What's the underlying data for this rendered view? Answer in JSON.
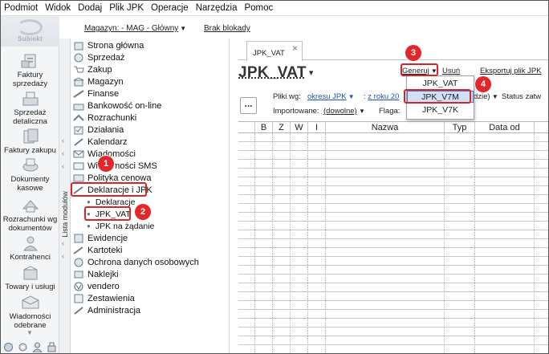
{
  "menu": [
    "Podmiot",
    "Widok",
    "Dodaj",
    "Plik JPK",
    "Operacje",
    "Narzędzia",
    "Pomoc"
  ],
  "toolbar": {
    "warehouse": "Magazyn: - MAG - Główny",
    "sync": "Brak blokady"
  },
  "logo": "Subiekt",
  "sidebar": [
    {
      "label_line1": "Faktury",
      "label_line2": "sprzedaży"
    },
    {
      "label_line1": "Sprzedaż",
      "label_line2": "detaliczna"
    },
    {
      "label_line1": "Faktury zakupu",
      "label_line2": ""
    },
    {
      "label_line1": "Dokumenty",
      "label_line2": "kasowe"
    },
    {
      "label_line1": "Rozrachunki wg",
      "label_line2": "dokumentów"
    },
    {
      "label_line1": "Kontrahenci",
      "label_line2": ""
    },
    {
      "label_line1": "Towary i usługi",
      "label_line2": ""
    },
    {
      "label_line1": "Wiadomości",
      "label_line2": "odebrane"
    }
  ],
  "modules_label": "Lista modułów",
  "tree": [
    "Strona główna",
    "Sprzedaż",
    "Zakup",
    "Magazyn",
    "Finanse",
    "Bankowość on-line",
    "Rozrachunki",
    "Działania",
    "Kalendarz",
    "Wiadomości",
    "Wiadomości SMS",
    "Polityka cenowa",
    "Deklaracje i JPK"
  ],
  "tree_sub": [
    "Deklaracje",
    "JPK_VAT",
    "JPK na żądanie"
  ],
  "tree_after": [
    "Ewidencje",
    "Kartoteki",
    "Ochrona danych osobowych",
    "Naklejki",
    "vendero",
    "Zestawienia",
    "Administracja"
  ],
  "tab": {
    "label": "JPK_VAT",
    "close": "×"
  },
  "page": {
    "title": "JPK_VAT"
  },
  "actions": {
    "generate": "Generuj",
    "delete": "Usuń",
    "export": "Eksportuj plik JPK"
  },
  "filters": {
    "files_by_label": "Pliki wg:",
    "files_by_value": "okresu JPK",
    "year_prefix": ":",
    "year_value": "z roku 20",
    "year_suffix": "dzie)",
    "status_label": "Status zatw",
    "imported_label": "Importowane:",
    "imported_value": "(dowolne)",
    "flag_label": "Flaga:",
    "more": "..."
  },
  "grid_columns": [
    "B",
    "Z",
    "W",
    "I",
    "Nazwa",
    "Typ",
    "Data od"
  ],
  "dropdown": [
    "JPK_VAT",
    "JPK_V7M",
    "JPK_V7K"
  ],
  "callouts": [
    "1",
    "2",
    "3",
    "4"
  ],
  "colors": {
    "callout_red": "#e2262c",
    "link_blue": "#1a55b8",
    "selection": "#cfe0f7"
  }
}
